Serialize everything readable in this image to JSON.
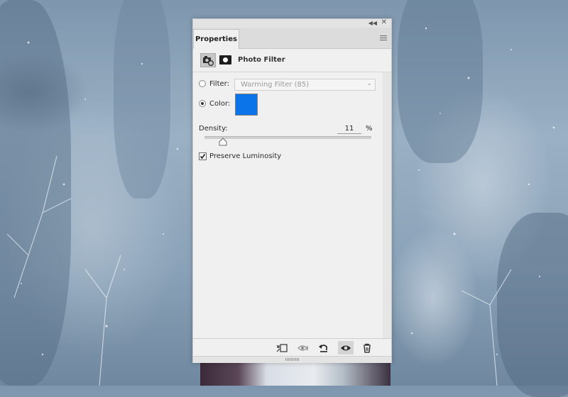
{
  "panel": {
    "tab_label": "Properties",
    "title": "Photo Filter",
    "header_icons": [
      "adjustment-camera-icon",
      "layer-mask-icon"
    ],
    "window_icons": [
      "collapse-icon",
      "close-icon",
      "panel-menu-icon"
    ]
  },
  "filter": {
    "label": "Filter:",
    "selected": false,
    "value": "Warming Filter (85)"
  },
  "color": {
    "label": "Color:",
    "selected": true,
    "swatch": "#0a74e8"
  },
  "density": {
    "label": "Density:",
    "value": "11",
    "unit": "%",
    "level_percent": 11
  },
  "preserve_luminosity": {
    "label": "Preserve Luminosity",
    "checked": true
  },
  "footer_buttons": [
    {
      "name": "clip-to-layer-icon"
    },
    {
      "name": "view-previous-state-icon"
    },
    {
      "name": "reset-defaults-icon"
    },
    {
      "name": "toggle-visibility-icon",
      "active": true
    },
    {
      "name": "delete-adjustment-icon"
    }
  ]
}
